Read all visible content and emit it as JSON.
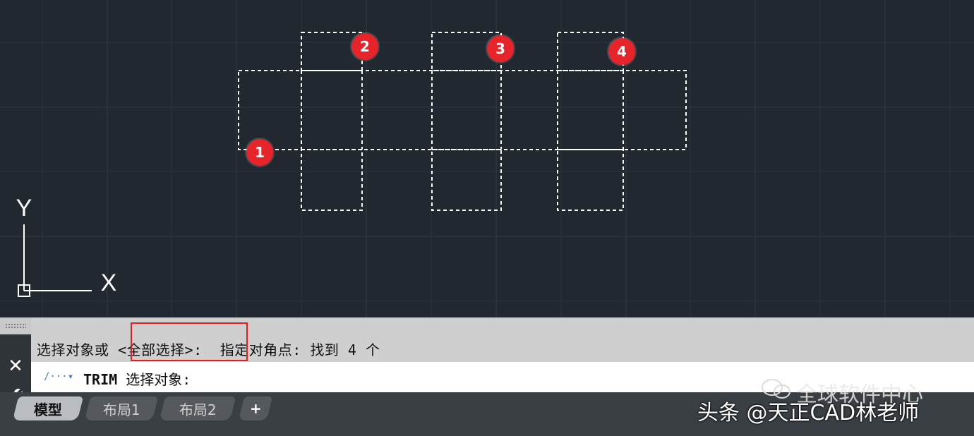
{
  "drawing": {
    "ucs_y_label": "Y",
    "ucs_x_label": "X",
    "markers": [
      "1",
      "2",
      "3",
      "4"
    ]
  },
  "command": {
    "history_text": "选择对象或 <全部选择>:  指定对角点: 找到 4 个",
    "prompt_icon": "/···▾",
    "command_name": "TRIM",
    "prompt_text": " 选择对象:"
  },
  "tabs": [
    "模型",
    "布局1",
    "布局2",
    "+"
  ],
  "watermark": {
    "top": "全球软件中心",
    "bottom": "头条 @天正CAD林老师"
  },
  "colors": {
    "canvas_bg": "#212830",
    "marker": "#e8242b",
    "highlight_box": "#e02020"
  }
}
